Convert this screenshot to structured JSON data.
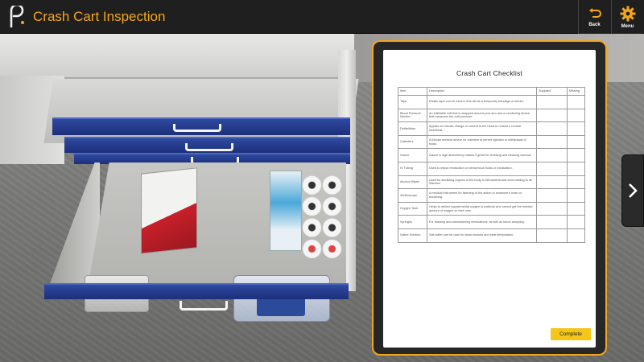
{
  "app": {
    "title": "Crash Cart Inspection"
  },
  "toolbar": {
    "back_label": "Back",
    "menu_label": "Menu"
  },
  "checklist": {
    "title": "Crash Cart Checklist",
    "headers": [
      "Item",
      "Description",
      "Supplied",
      "Missing"
    ],
    "rows": [
      {
        "item": "Tape",
        "desc": "Elastic tape can be used in first aid as a temporary bandage or suture."
      },
      {
        "item": "Blood Pressure Monitor",
        "desc": "An inflatable cuff that is wrapped around your arm and a monitoring device that measures the cuff pressure."
      },
      {
        "item": "Defibrillator",
        "desc": "Applies an electric charge or current to the heart to restore a normal heartbeat."
      },
      {
        "item": "Catheters",
        "desc": "A tubular medical device for insertion to permit injection or withdrawal of fluids."
      },
      {
        "item": "Gauze",
        "desc": "Gauze is high absorbency makes it great for dressing and cleaning wounds."
      },
      {
        "item": "IV Tubing",
        "desc": "Used to infuse medication or intravenous fluids or medication."
      },
      {
        "item": "Alcohol Wipes",
        "desc": "Used for sterilizing regions of the body to kill bacteria and virus leading to an infection."
      },
      {
        "item": "Stethoscope",
        "desc": "A medical instrument for listening to the action of someone's heart or breathing."
      },
      {
        "item": "Oxygen Tank",
        "desc": "Helps to deliver supplemental oxygen to patients who cannot get the needed amount of oxygen on their own."
      },
      {
        "item": "Syringes",
        "desc": "For drawing and administering medications, as well as blood sampling."
      },
      {
        "item": "Saline Solution",
        "desc": "Salt water can be used to clean wounds and treat dehydration."
      }
    ],
    "complete_label": "Complete"
  },
  "colors": {
    "accent": "#f3a61a",
    "topbar": "#1f1f1f",
    "button": "#f5c518",
    "drawer": "#1f3590"
  },
  "icons": {
    "logo": "app-logo-icon",
    "back": "undo-icon",
    "menu": "gear-icon",
    "next": "chevron-right-icon"
  }
}
